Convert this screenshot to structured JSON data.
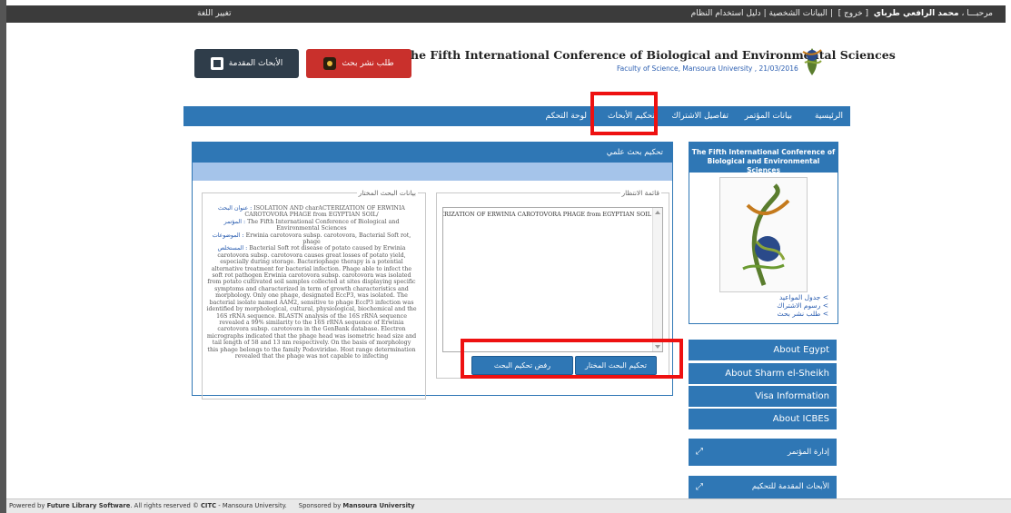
{
  "topbar": {
    "welcome": "مرحبـــا ،",
    "username": "محمد الرافعي طرباي",
    "logout": "[ خروج ]",
    "profile": "البيانات الشخصية",
    "manual": "دليل استخدام النظام",
    "separator": "|",
    "language": "تغيير اللغة"
  },
  "header": {
    "submitted_button": "الأبحاث المقدمة",
    "publish_button": "طلب نشر بحث",
    "conference_title": "he Fifth International Conference of Biological and Environmental Sciences",
    "conference_subtitle": "Faculty of Science, Mansoura University , 21/03/2016"
  },
  "nav": {
    "items": [
      "الرئيسية",
      "بيانات المؤتمر",
      "تفاصيل الاشتراك",
      "تحكيم الأبحاث",
      "لوحة التحكم"
    ]
  },
  "panel": {
    "title": "تحكيم بحث علمي",
    "details_legend": "بيانات البحث المختار",
    "waiting_legend": "قائمة الانتظار",
    "waiting_item": "ISOLATION AND charACTERIZATION OF ERWINIA CAROTOVORA PHAGE from EGYPTIAN SOIL",
    "review_button": "تحكيم البحث المختار",
    "reject_button": "رفض تحكيم البحث",
    "label_title": "عنوان البحث :",
    "value_title": "ISOLATION AND charACTERIZATION OF ERWINIA CAROTOVORA PHAGE from EGYPTIAN SOIL/",
    "label_conference": "المؤتمر :",
    "value_conference": "The Fifth International Conference of Biological and Environmental Sciences",
    "label_topics": "الموضوعات :",
    "value_topics": "Erwinia carotovora subsp. carotovora, Bacterial Soft rot, phage",
    "label_abstract": "المستخلص :",
    "value_abstract": "Bacterial Soft rot disease of potato caused by Erwinia carotovora subsp. carotovora causes great losses of potato yield, especially during storage. Bacteriophage therapy is a potential alternative treatment for bacterial infection. Phage able to infect the soft rot pathogen Erwinia carotovora subsp. carotovora was isolated from potato cultivated soil samples collected at sites displaying specific symptoms and characterized in term of growth characteristics and morphology. Only one phage, designated EccP3, was isolated. The bacterial isolate named AAM2, sensitive to phage EccP3 infection was identified by morphological, cultural, physiological, biochemical and the 16S rRNA sequence. BLASTN analysis of the 16S rRNA sequence revealed a 99% similarity to the 16S rRNA sequence of Erwinia carotovora subsp. carotovora in the GenBank database. Electron micrographs indicated that the phage head was isometric head size and tail length of 58 and 13 nm respectively. On the basis of morphology this phage belongs to the family Podoviridae. Host range determination revealed that the phage was not capable to infecting"
  },
  "sidebar": {
    "box_title": "The Fifth International Conference of Biological and Environmental Sciences",
    "links": [
      "> جدول المواعيد",
      "> رسوم الاشتراك",
      "> طلب نشر بحث"
    ],
    "buttons": [
      "About Egypt",
      "About Sharm el-Sheikh",
      "Visa Information",
      "About ICBES"
    ],
    "manage_conference": "إدارة المؤتمر",
    "submitted_for_review": "الأبحاث المقدمة للتحكيم",
    "expand_symbol": "⤢"
  },
  "footer": {
    "powered_prefix": "Powered by",
    "powered_by": "Future Library Software",
    "rights": ". All rights reserved ©",
    "citc": "CITC",
    "univ": "- Mansoura University.",
    "sponsored_prefix": "Sponsored by",
    "sponsor": "Mansoura University"
  },
  "colors": {
    "accent_blue": "#2f77b5",
    "light_blue": "#a5c4ea",
    "red_button": "#c9302c",
    "dark_button": "#2f3d4a",
    "highlight_red": "#e11111"
  }
}
